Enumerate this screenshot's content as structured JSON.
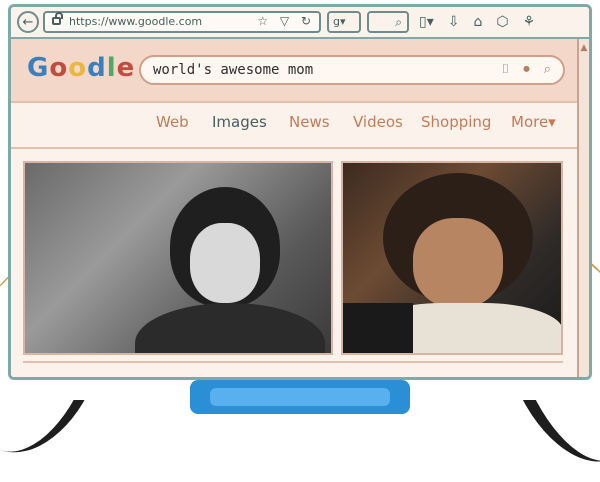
{
  "browser": {
    "url": "https://www.goodle.com",
    "url_icons": "☆ ▽ ↻",
    "engine_badge": "g▾",
    "small_search_icon": "⌕",
    "toolbar_icons": [
      "▯▾",
      "⇩",
      "⌂",
      "⬡",
      "⚘"
    ]
  },
  "page": {
    "logo": {
      "g": "G",
      "o1": "o",
      "o2": "o",
      "d": "d",
      "l": "l",
      "e": "e"
    },
    "search": {
      "query": "world's awesome mom",
      "icons": [
        "camera-icon",
        "mic-icon",
        "search-icon"
      ],
      "icon_glyphs": [
        "⌷",
        "⏺",
        "⌕"
      ]
    },
    "tabs": [
      {
        "label": "Web"
      },
      {
        "label": "Images"
      },
      {
        "label": "News"
      },
      {
        "label": "Videos"
      },
      {
        "label": "Shopping"
      },
      {
        "label": "More▾"
      }
    ],
    "active_tab_index": 1
  },
  "colors": {
    "frame": "#7fa9a6",
    "page_bg": "#fbf2ec",
    "header_bg": "#f3d7c9",
    "accent": "#c47c57",
    "active": "#45605f"
  }
}
